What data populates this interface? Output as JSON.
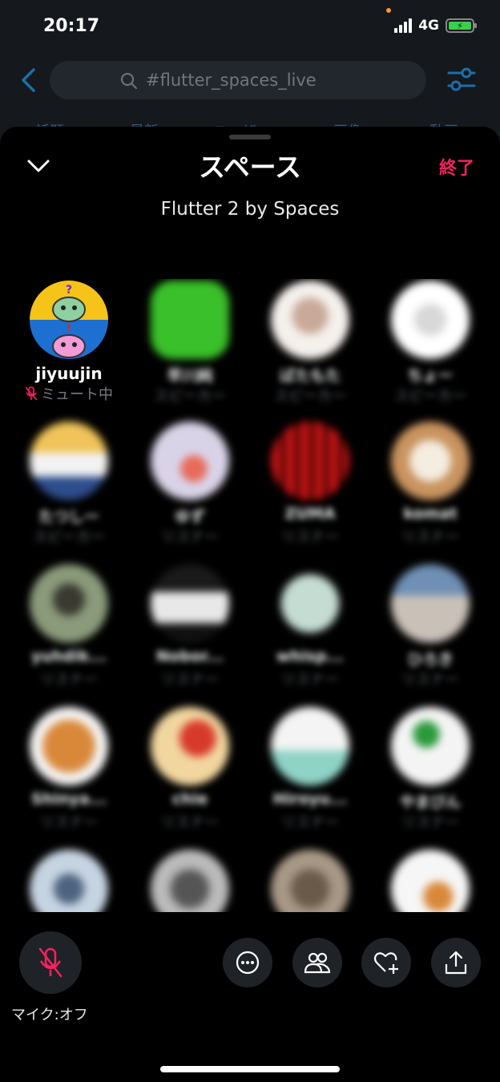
{
  "status_bar": {
    "time": "20:17",
    "network": "4G",
    "battery_color": "#37d049"
  },
  "background": {
    "search_query": "#flutter_spaces_live",
    "tabs": [
      "話題",
      "最新",
      "ユーザー",
      "画像",
      "動画"
    ]
  },
  "sheet": {
    "title": "スペース",
    "end_label": "終了",
    "space_name": "Flutter 2 by Spaces",
    "accent_color": "#f4245e"
  },
  "participants": [
    {
      "name": "jiyuujin",
      "role": "ミュート中",
      "muted": true
    },
    {
      "name": "早川純",
      "role": "スピーカー"
    },
    {
      "name": "ばたもた",
      "role": "スピーカー"
    },
    {
      "name": "ちょー",
      "role": "スピーカー"
    },
    {
      "name": "たつしー",
      "role": "スピーカー"
    },
    {
      "name": "ゆず",
      "role": "リスナー"
    },
    {
      "name": "ZUMA",
      "role": "リスナー"
    },
    {
      "name": "komat",
      "role": "リスナー"
    },
    {
      "name": "yuhdik...",
      "role": "リスナー"
    },
    {
      "name": "Nobor...",
      "role": "リスナー"
    },
    {
      "name": "whisp...",
      "role": "リスナー"
    },
    {
      "name": "ひろき",
      "role": "リスナー"
    },
    {
      "name": "Shinya...",
      "role": "リスナー"
    },
    {
      "name": "chie",
      "role": "リスナー"
    },
    {
      "name": "Hiroyu...",
      "role": "リスナー"
    },
    {
      "name": "やまびん",
      "role": "リスナー"
    },
    {
      "name": "",
      "role": ""
    },
    {
      "name": "",
      "role": ""
    },
    {
      "name": "",
      "role": ""
    },
    {
      "name": "",
      "role": ""
    }
  ],
  "controls": {
    "mic_label": "マイク:オフ"
  }
}
